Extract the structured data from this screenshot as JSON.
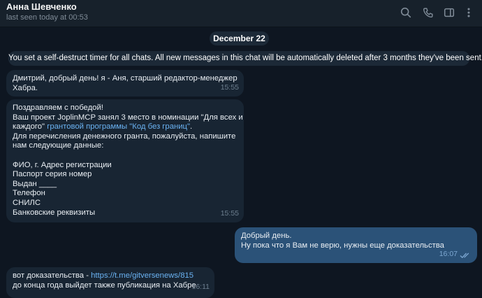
{
  "header": {
    "title": "Анна Шевченко",
    "status": "last seen today at 00:53",
    "icons": [
      "search-icon",
      "phone-icon",
      "sidebar-toggle-icon",
      "more-vertical-icon"
    ]
  },
  "date_separator": "December 22",
  "service_message": "You set a self-destruct timer for all chats. All new messages in this chat will be automatically deleted after 3 months they've been sent.",
  "messages": [
    {
      "line1": "Дмитрий, добрый день! я - Аня, старший редактор-менеджер",
      "line2": "Хабра.",
      "time": "15:55"
    },
    {
      "line1": "Поздравляем с победой!",
      "line2": "Ваш проект JoplinMCP занял 3 место в номинации \"Для всех и",
      "line3_pre": "каждого\" ",
      "line3_link": "грантовой программы \"Код без границ\"",
      "line3_post": ".",
      "line4": "Для перечисления денежного гранта, пожалуйста, напишите",
      "line5": "нам следующие данные:",
      "line6": "",
      "line7": "ФИО, г. Адрес регистрации",
      "line8": "Паспорт серия номер",
      "line9": "Выдан ____",
      "line10": "Телефон",
      "line11": "СНИЛС",
      "line12": "Банковские реквизиты",
      "time": "15:55"
    },
    {
      "line1": "Добрый день.",
      "line2": "Ну пока что я Вам не верю, нужны еще доказательства",
      "time": "16:07",
      "outgoing": true
    },
    {
      "line1_pre": "вот доказательства - ",
      "line1_link": "https://t.me/gitversenews/815",
      "line2": "до конца года выйдет также публикация на Хабре",
      "time": "16:11"
    }
  ],
  "colors": {
    "background": "#0e1621",
    "header": "#17212b",
    "incoming_bubble": "#182533",
    "outgoing_bubble": "#2b5278",
    "link": "#6ab2f2"
  }
}
